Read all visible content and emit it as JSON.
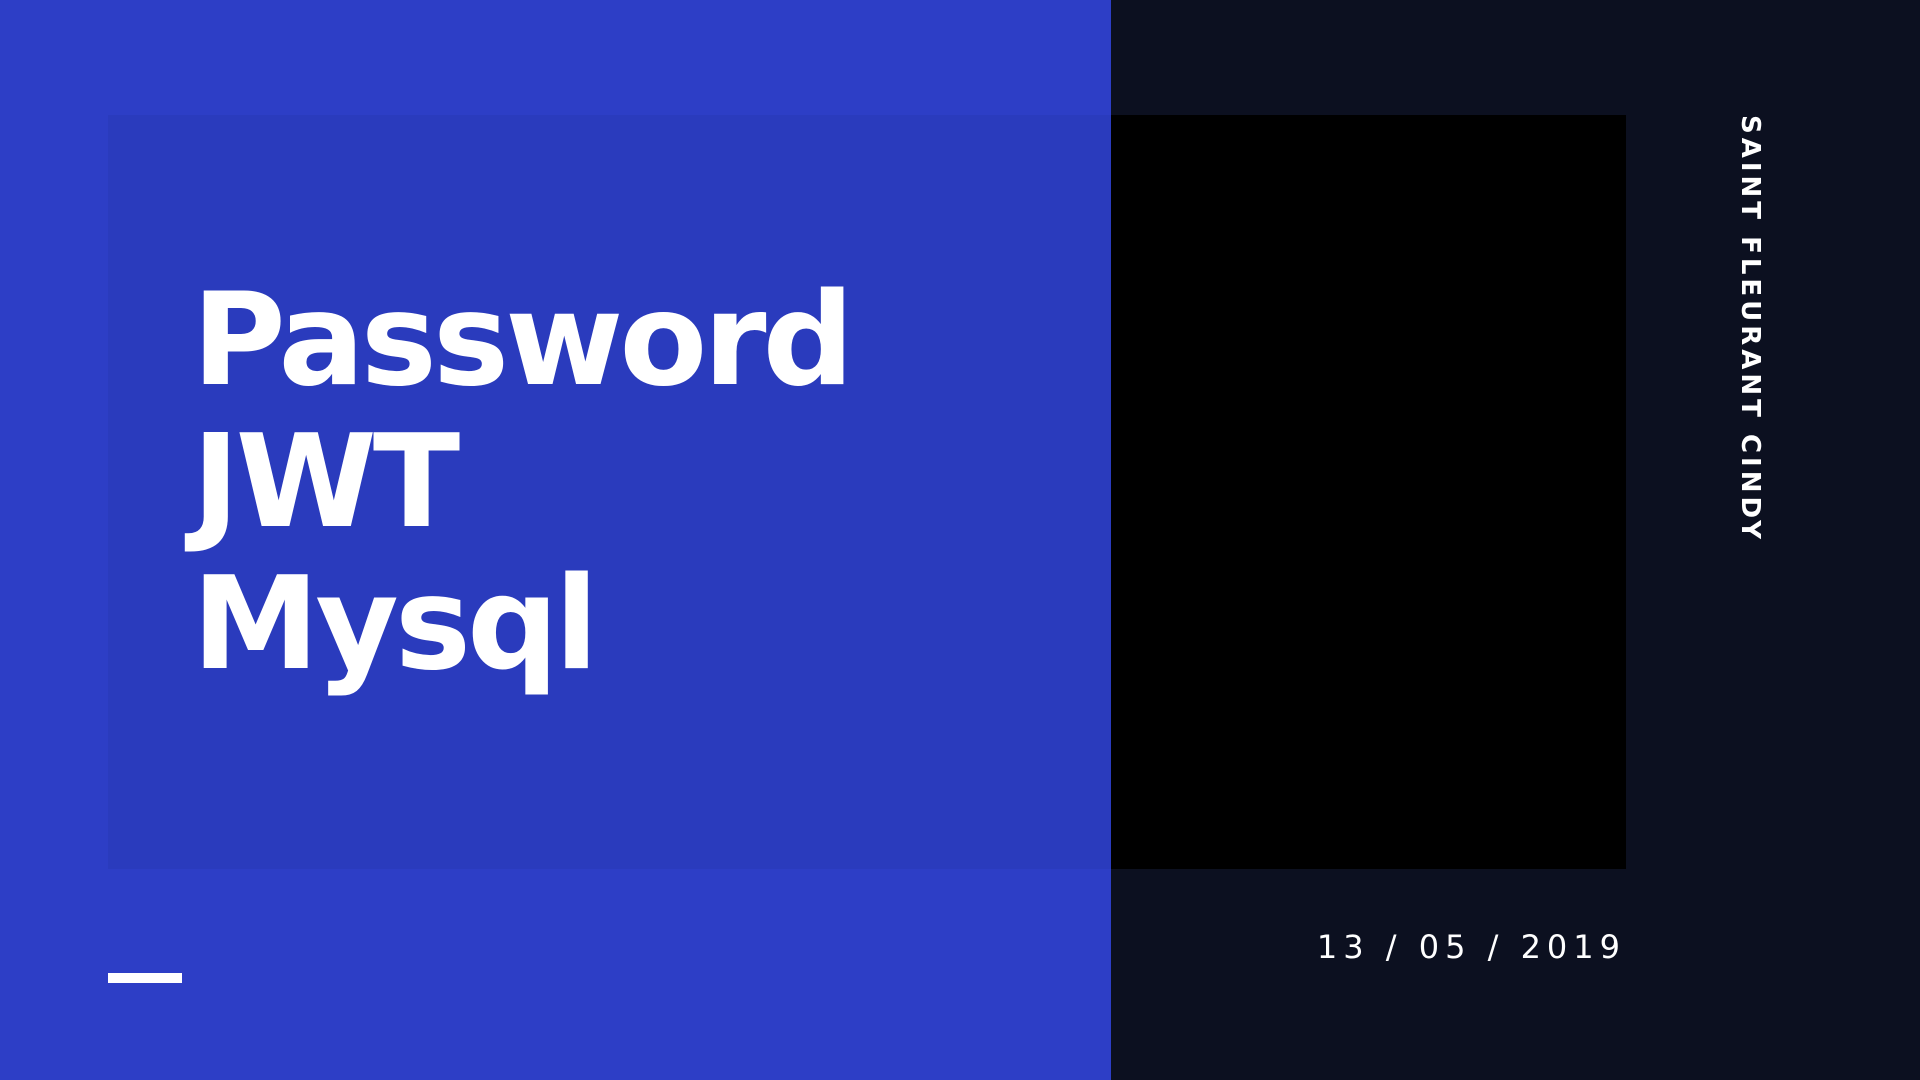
{
  "slide": {
    "title_lines": [
      "Password",
      "JWT",
      "Mysql"
    ],
    "author": "SAINT FLEURANT CINDY",
    "date": "13 / 05 / 2019"
  },
  "colors": {
    "left_background": "#2d3ec6",
    "title_card": "#2a3bbd",
    "right_background": "#0c1020",
    "image_placeholder": "#000000",
    "text": "#ffffff"
  }
}
